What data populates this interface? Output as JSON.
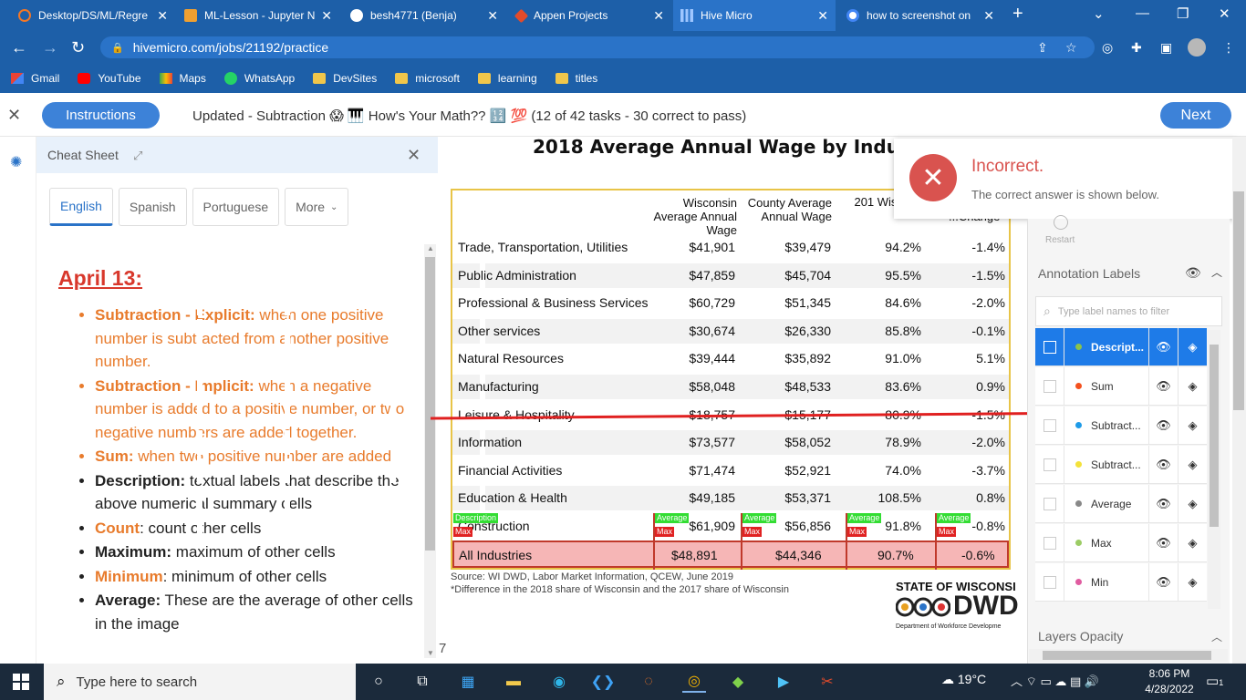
{
  "browser": {
    "tabs": [
      {
        "label": "Desktop/DS/ML/Regre",
        "icon": "jupyter-icon",
        "icon_color": "#f37726"
      },
      {
        "label": "ML-Lesson - Jupyter N",
        "icon": "notebook-icon",
        "icon_color": "#f0a030"
      },
      {
        "label": "besh4771 (Benja)",
        "icon": "github-icon",
        "icon_color": "#ffffff"
      },
      {
        "label": "Appen Projects",
        "icon": "appen-icon",
        "icon_color": "#e24b2b"
      },
      {
        "label": "Hive Micro",
        "icon": "hive-icon",
        "icon_color": "#9ec6ff"
      },
      {
        "label": "how to screenshot on",
        "icon": "google-icon",
        "icon_color": "#ffffff"
      }
    ],
    "url": "hivemicro.com/jobs/21192/practice",
    "bookmarks": [
      "Gmail",
      "YouTube",
      "Maps",
      "WhatsApp",
      "DevSites",
      "microsoft",
      "learning",
      "titles"
    ]
  },
  "header": {
    "instructions_label": "Instructions",
    "task_title": "Updated - Subtraction 😱 🎹 How's Your Math?? 🔢 💯 (12 of 42 tasks - 30 correct to pass)",
    "next_label": "Next"
  },
  "cheatsheet": {
    "title": "Cheat Sheet",
    "langs": [
      "English",
      "Spanish",
      "Portuguese",
      "More"
    ],
    "heading": "April 13:",
    "items": [
      {
        "term": "Subtraction - Explicit:",
        "desc": " when one positive number is subtracted from another positive number."
      },
      {
        "term": "Subtraction - Implicit:",
        "desc": "  when a negative number is added to a positive number, or two negative numbers are added together."
      },
      {
        "term": "Sum:",
        "desc": " when two positive number are added."
      },
      {
        "term": "Description:",
        "desc": " textual labels that describe the above numerical summary cells"
      },
      {
        "term": "Count",
        "desc": ":  count other cells"
      },
      {
        "term": "Maximum:",
        "desc": " maximum of other cells"
      },
      {
        "term": "Minimum",
        "desc": ": minimum of other cells"
      },
      {
        "term": "Average:",
        "desc": " These are the average of other cells in the image"
      }
    ]
  },
  "figure": {
    "title": "2018 Average Annual Wage by Indus",
    "col1": "Wisconsin Average Annual Wage",
    "col2": "County Average Annual Wage",
    "col3": "201 Wisco...",
    "col4": "...Change",
    "rows": [
      [
        "Trade, Transportation, Utilities",
        "$41,901",
        "$39,479",
        "94.2%",
        "-1.4%"
      ],
      [
        "Public Administration",
        "$47,859",
        "$45,704",
        "95.5%",
        "-1.5%"
      ],
      [
        "Professional & Business Services",
        "$60,729",
        "$51,345",
        "84.6%",
        "-2.0%"
      ],
      [
        "Other services",
        "$30,674",
        "$26,330",
        "85.8%",
        "-0.1%"
      ],
      [
        "Natural Resources",
        "$39,444",
        "$35,892",
        "91.0%",
        "5.1%"
      ],
      [
        "Manufacturing",
        "$58,048",
        "$48,533",
        "83.6%",
        "0.9%"
      ],
      [
        "Leisure & Hospitality",
        "$18,757",
        "$15,177",
        "80.9%",
        "-1.5%"
      ],
      [
        "Information",
        "$73,577",
        "$58,052",
        "78.9%",
        "-2.0%"
      ],
      [
        "Financial Activities",
        "$71,474",
        "$52,921",
        "74.0%",
        "-3.7%"
      ],
      [
        "Education & Health",
        "$49,185",
        "$53,371",
        "108.5%",
        "0.8%"
      ],
      [
        "Construction",
        "$61,909",
        "$56,856",
        "91.8%",
        "-0.8%"
      ]
    ],
    "total": [
      "All Industries",
      "$48,891",
      "$44,346",
      "90.7%",
      "-0.6%"
    ],
    "tag_desc": "Description",
    "tag_avg": "Average",
    "tag_max": "Max",
    "source": "Source: WI DWD, Labor Market Information, QCEW, June 2019",
    "footnote": "*Difference in the 2018 share of Wisconsin and the 2017 share of Wisconsin",
    "org1": "STATE OF WISCONSI",
    "org2": "DWD",
    "org3": "Department of Workforce Developme",
    "page": "7"
  },
  "toast": {
    "title": "Incorrect.",
    "message": "The correct answer is shown below."
  },
  "panel": {
    "restart": "Restart",
    "annotation_labels": "Annotation Labels",
    "filter_placeholder": "Type label names to filter",
    "labels": [
      {
        "name": "Descript...",
        "color": "#8bc34a",
        "selected": true
      },
      {
        "name": "Sum",
        "color": "#f4511e",
        "selected": false
      },
      {
        "name": "Subtract...",
        "color": "#1e9be8",
        "selected": false
      },
      {
        "name": "Subtract...",
        "color": "#f4e23a",
        "selected": false
      },
      {
        "name": "Average",
        "color": "#888888",
        "selected": false
      },
      {
        "name": "Max",
        "color": "#9ccc65",
        "selected": false
      },
      {
        "name": "Min",
        "color": "#e05ca0",
        "selected": false
      }
    ],
    "layers_opacity": "Layers Opacity"
  },
  "taskbar": {
    "search_placeholder": "Type here to search",
    "temperature": "19°C",
    "time": "8:06 PM",
    "date": "4/28/2022",
    "notifications": "1"
  }
}
